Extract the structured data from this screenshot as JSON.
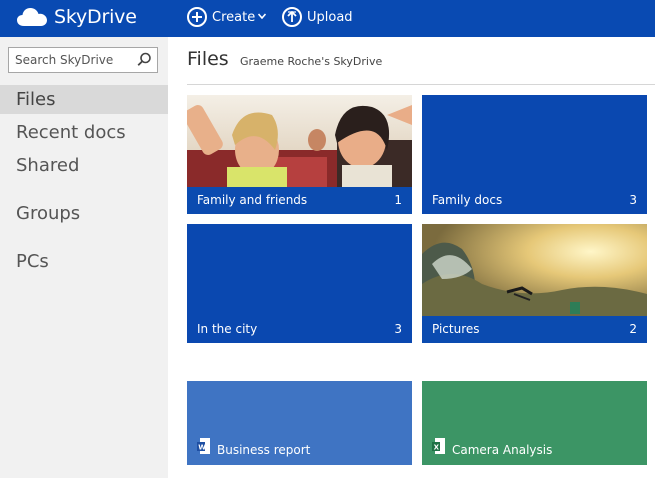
{
  "app": {
    "brand": "SkyDrive",
    "brand_color": "#094ab2",
    "create_label": "Create",
    "upload_label": "Upload"
  },
  "sidebar": {
    "search_placeholder": "Search SkyDrive",
    "items": [
      {
        "label": "Files",
        "active": true
      },
      {
        "label": "Recent docs"
      },
      {
        "label": "Shared"
      },
      {
        "label": "Groups"
      },
      {
        "label": "PCs"
      }
    ]
  },
  "header": {
    "title": "Files",
    "subtitle": "Graeme Roche's SkyDrive"
  },
  "tiles": [
    {
      "label": "Family and friends",
      "count": "1",
      "kind": "photo-folder"
    },
    {
      "label": "Family docs",
      "count": "3",
      "kind": "folder",
      "color": "#0a48b0"
    },
    {
      "label": "In the city",
      "count": "3",
      "kind": "folder",
      "color": "#0a48b0"
    },
    {
      "label": "Pictures",
      "count": "2",
      "kind": "photo-folder"
    },
    {
      "label": "Business report",
      "kind": "word-doc",
      "color": "#3f74c3",
      "icon": "word-icon"
    },
    {
      "label": "Camera Analysis",
      "kind": "excel-doc",
      "color": "#3c9565",
      "icon": "excel-icon"
    }
  ]
}
